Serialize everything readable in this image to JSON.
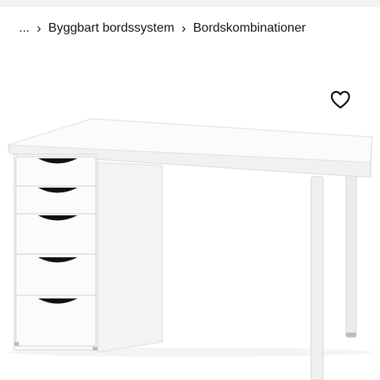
{
  "breadcrumb": {
    "items": [
      {
        "label": "..."
      },
      {
        "label": "Byggbart bordssystem"
      },
      {
        "label": "Bordskombinationer"
      }
    ],
    "separator_icon": "chevron-right-icon"
  },
  "favorite": {
    "icon": "heart-outline-icon"
  },
  "product": {
    "image": "white-desk-with-drawer-unit",
    "drawer_count": 5
  },
  "colors": {
    "text": "#111111",
    "topbar": "#f2f2f2",
    "background": "#ffffff"
  }
}
